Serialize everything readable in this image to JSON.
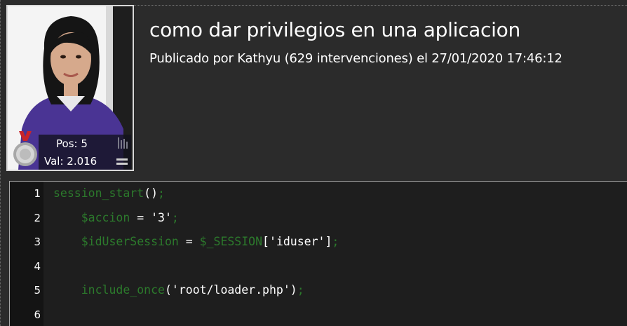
{
  "post": {
    "title": "como dar privilegios en una aplicacion",
    "meta": "Publicado por Kathyu (629 intervenciones) el 27/01/2020 17:46:12"
  },
  "author_card": {
    "position_label": "Pos: 5",
    "value_label": "Val: 2.016",
    "medal_icon": "silver-medal-icon",
    "ranking_icon": "bar-chart-icon",
    "rating_icon": "equals-icon"
  },
  "code": {
    "lines": [
      {
        "number": "1",
        "tokens": [
          {
            "t": "session_start",
            "c": "green"
          },
          {
            "t": "()",
            "c": "white"
          },
          {
            "t": ";",
            "c": "green"
          }
        ]
      },
      {
        "number": "2",
        "tokens": [
          {
            "t": "    ",
            "c": "white"
          },
          {
            "t": "$accion",
            "c": "green"
          },
          {
            "t": " = ",
            "c": "white"
          },
          {
            "t": "'3'",
            "c": "white"
          },
          {
            "t": ";",
            "c": "green"
          }
        ]
      },
      {
        "number": "3",
        "tokens": [
          {
            "t": "    ",
            "c": "white"
          },
          {
            "t": "$idUserSession",
            "c": "green"
          },
          {
            "t": " = ",
            "c": "white"
          },
          {
            "t": "$_SESSION",
            "c": "green"
          },
          {
            "t": "['iduser']",
            "c": "white"
          },
          {
            "t": ";",
            "c": "green"
          }
        ]
      },
      {
        "number": "4",
        "tokens": []
      },
      {
        "number": "5",
        "tokens": [
          {
            "t": "    ",
            "c": "white"
          },
          {
            "t": "include_once",
            "c": "green"
          },
          {
            "t": "('root/loader.php')",
            "c": "white"
          },
          {
            "t": ";",
            "c": "green"
          }
        ]
      },
      {
        "number": "6",
        "tokens": []
      }
    ]
  },
  "colors": {
    "background": "#2b2b2b",
    "code_background": "#1e1e1e",
    "gutter_background": "#141414",
    "keyword_green": "#2c7a2c",
    "text_white": "#ffffff"
  }
}
